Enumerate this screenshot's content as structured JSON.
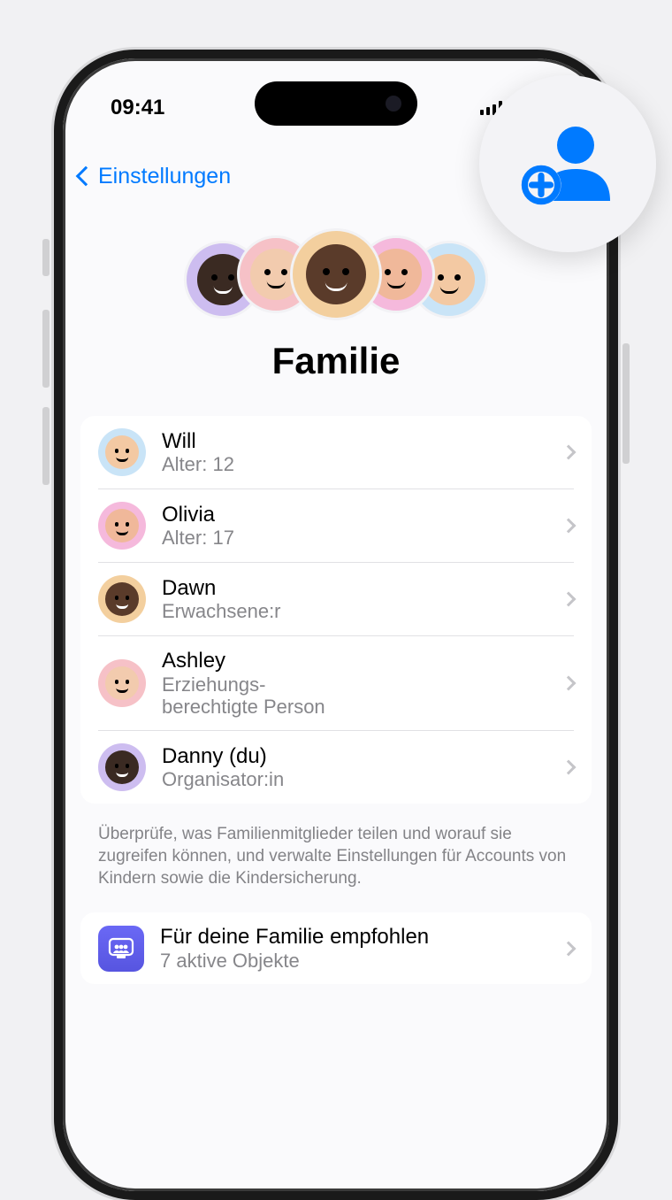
{
  "status": {
    "time": "09:41"
  },
  "nav": {
    "back_label": "Einstellungen"
  },
  "header": {
    "title": "Familie"
  },
  "cluster_colors": [
    "#cdbdf0",
    "#f6c1c7",
    "#f3cf9e",
    "#f5b9dc",
    "#c9e4f7"
  ],
  "members": [
    {
      "name": "Will",
      "sub": "Alter: 12",
      "bg": "#c9e4f7",
      "skin": "#f3c9a3"
    },
    {
      "name": "Olivia",
      "sub": "Alter: 17",
      "bg": "#f5b9dc",
      "skin": "#f0b89a"
    },
    {
      "name": "Dawn",
      "sub": "Erwachsene:r",
      "bg": "#f3cf9e",
      "skin": "#5a3b2a"
    },
    {
      "name": "Ashley",
      "sub": "Erziehungs-\nberechtigte Person",
      "bg": "#f6c1c7",
      "skin": "#f2cbae"
    },
    {
      "name": "Danny (du)",
      "sub": "Organisator:in",
      "bg": "#cdbdf0",
      "skin": "#3a2a22"
    }
  ],
  "members_footer": "Überprüfe, was Familienmitglieder teilen und worauf sie zugreifen können, und verwalte Einstellungen für Accounts von Kindern sowie die Kindersicherung.",
  "recommended": {
    "title": "Für deine Familie empfohlen",
    "sub": "7 aktive Objekte"
  }
}
